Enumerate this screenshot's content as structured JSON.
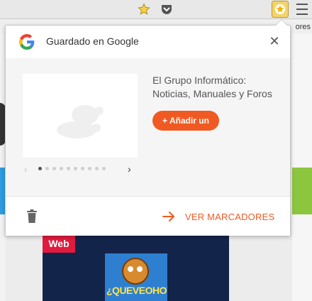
{
  "toolbar": {
    "bookmarks_bar_text": "ores"
  },
  "popup": {
    "header_title": "Guardado en Google",
    "item_title": "El Grupo Informático: Noticias, Manuales y Foros",
    "add_button_label": "+ Añadir un",
    "carousel_total_dots": 10,
    "carousel_active_index": 0,
    "view_bookmarks_label": "VER MARCADORES"
  },
  "background_page": {
    "web_tag": "Web",
    "logo_text": "¿QUEVEOHOY?"
  },
  "colors": {
    "accent": "#f05a22",
    "google_blue": "#4285f4",
    "google_red": "#ea4335",
    "google_yellow": "#fbbc05",
    "google_green": "#34a853"
  },
  "icons": [
    "star-icon",
    "pocket-icon",
    "bookmark-extension-icon",
    "hamburger-menu-icon",
    "google-logo-icon",
    "close-icon",
    "placeholder-image-icon",
    "chevron-left-icon",
    "chevron-right-icon",
    "trash-icon",
    "arrow-right-icon"
  ]
}
